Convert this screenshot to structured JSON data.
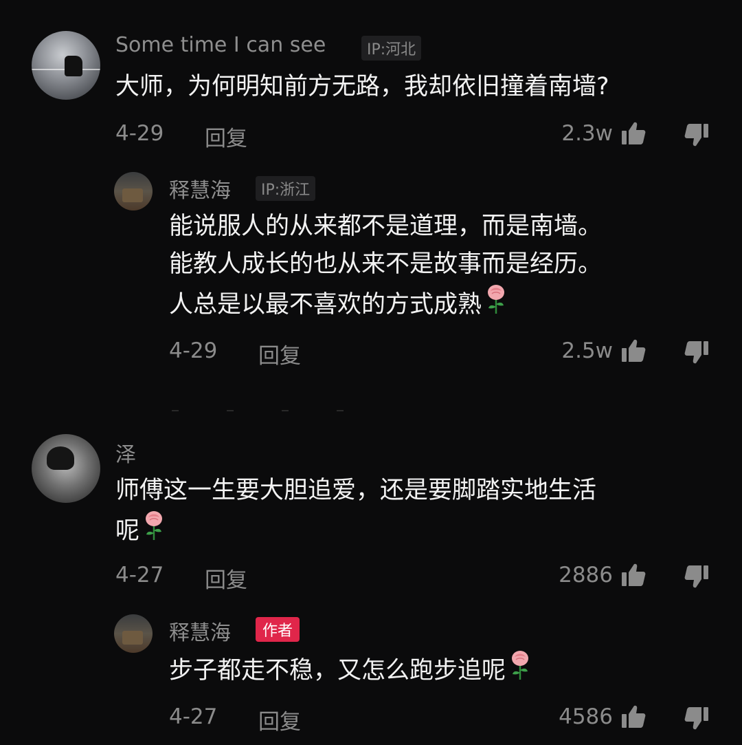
{
  "comments": [
    {
      "username": "Some time I can see",
      "ip": "IP:河北",
      "avatar": "sea-landscape-avatar",
      "lines": [
        "大师，为何明知前方无路，我却依旧撞着南墙?"
      ],
      "date": "4-29",
      "reply_label": "回复",
      "likes": "2.3w",
      "reply": {
        "username": "释慧海",
        "ip": "IP:浙江",
        "avatar": "monk-avatar",
        "lines": [
          "能说服人的从来都不是道理，而是南墙。",
          "能教人成长的也从来不是故事而是经历。",
          "人总是以最不喜欢的方式成熟"
        ],
        "has_rose": true,
        "date": "4-29",
        "reply_label": "回复",
        "likes": "2.5w"
      }
    },
    {
      "username": "泽",
      "avatar": "anime-avatar",
      "lines": [
        "师傅这一生要大胆追爱，还是要脚踏实地生活",
        "呢"
      ],
      "has_rose": true,
      "date": "4-27",
      "reply_label": "回复",
      "likes": "2886",
      "reply": {
        "username": "释慧海",
        "author_tag": "作者",
        "avatar": "monk-avatar",
        "lines": [
          "步子都走不稳，又怎么跑步追呢"
        ],
        "has_rose": true,
        "date": "4-27",
        "reply_label": "回复",
        "likes": "4586"
      }
    }
  ],
  "icons": {
    "like": "thumbs-up-icon",
    "dislike": "thumbs-down-icon",
    "rose": "rose-emoji-icon"
  },
  "colors": {
    "background": "#0b0b0c",
    "author_tag": "#e0264a",
    "meta_text": "#8b8b8b"
  }
}
